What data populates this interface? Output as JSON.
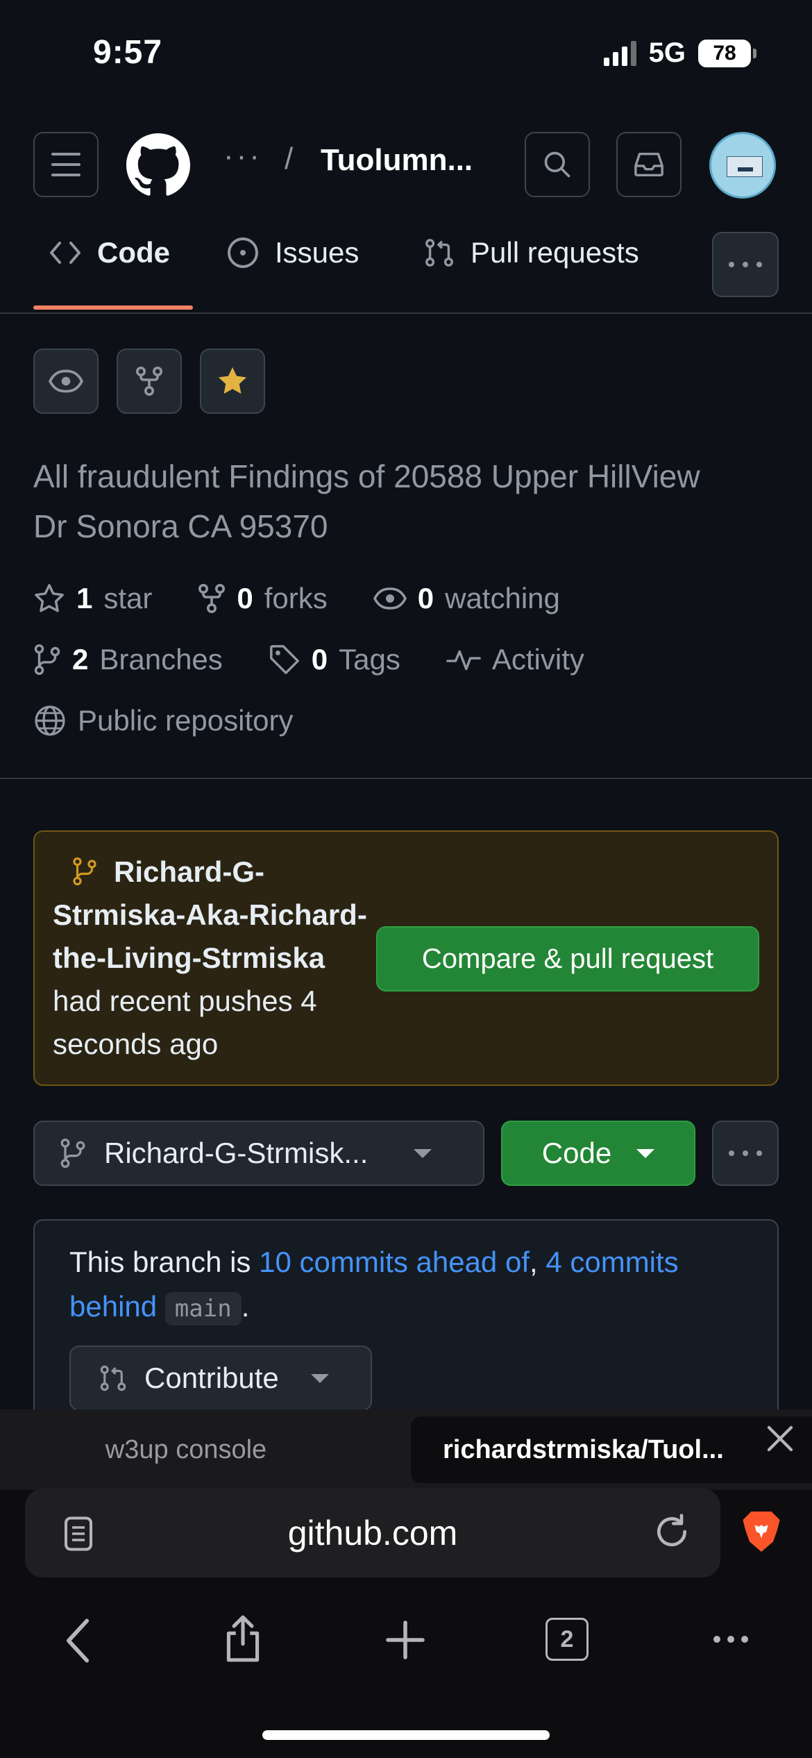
{
  "status_bar": {
    "time": "9:57",
    "network": "5G",
    "battery": "78"
  },
  "header": {
    "breadcrumb_more": "···",
    "separator": "/",
    "repo_title": "Tuolumn..."
  },
  "repo_tabs": [
    {
      "label": "Code",
      "active": true
    },
    {
      "label": "Issues",
      "active": false
    },
    {
      "label": "Pull requests",
      "active": false
    }
  ],
  "repo": {
    "description": "All fraudulent Findings of 20588 Upper HillView Dr Sonora CA 95370",
    "stars_count": "1",
    "stars_label": "star",
    "forks_count": "0",
    "forks_label": "forks",
    "watching_count": "0",
    "watching_label": "watching",
    "branches_count": "2",
    "branches_label": "Branches",
    "tags_count": "0",
    "tags_label": "Tags",
    "activity_label": "Activity",
    "visibility_label": "Public repository"
  },
  "push_banner": {
    "branch_name": "Richard-G-Strmiska-Aka-Richard-the-Living-Strmiska",
    "message": " had recent pushes 4 seconds ago",
    "button_label": "Compare & pull request"
  },
  "branch_bar": {
    "selected_branch": "Richard-G-Strmisk...",
    "code_button_label": "Code"
  },
  "ahead_behind": {
    "prefix": "This branch is ",
    "ahead_link": "10 commits ahead of",
    "comma": ", ",
    "behind_link": "4 commits behind",
    "base_branch": "main",
    "suffix": ".",
    "contribute_label": "Contribute"
  },
  "browser": {
    "tab_inactive": "w3up console",
    "tab_active": "richardstrmiska/Tuol...",
    "url": "github.com",
    "tab_count": "2"
  },
  "colors": {
    "background": "#0d1117",
    "accent_underline": "#f78166",
    "link": "#4493f8",
    "primary_button": "#238636",
    "star": "#e3b341"
  }
}
